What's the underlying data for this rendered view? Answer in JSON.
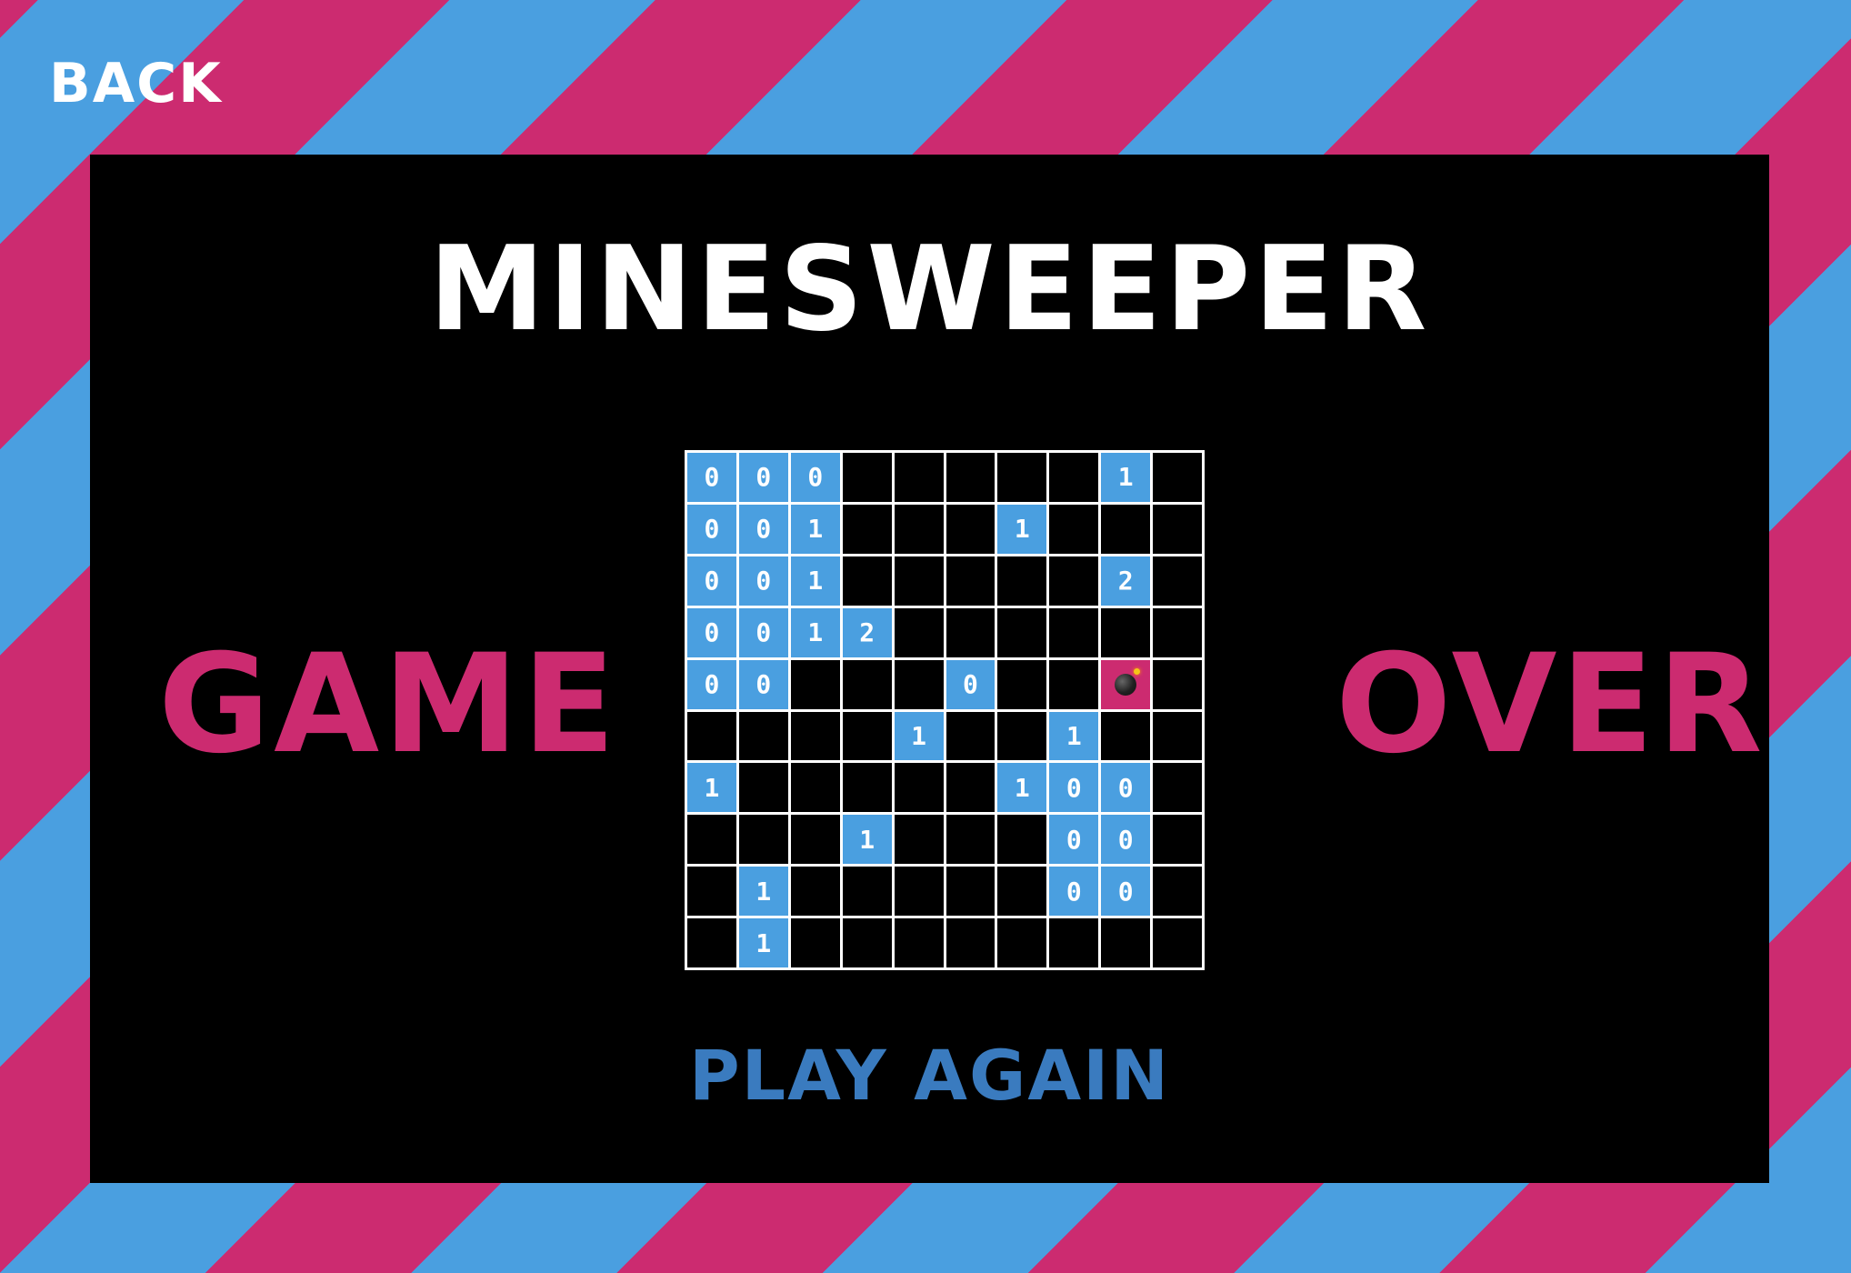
{
  "nav": {
    "back_label": "BACK"
  },
  "game": {
    "title": "MINESWEEPER",
    "status_left": "GAME",
    "status_right": "OVER",
    "play_again_label": "PLAY AGAIN"
  },
  "colors": {
    "stripe_blue": "#4a9fe0",
    "stripe_pink": "#cc2b70",
    "panel": "#000000",
    "revealed_cell": "#4a9fe0",
    "mine_cell": "#cc2b70",
    "play_again": "#3a7bbf"
  },
  "board": {
    "rows": 10,
    "cols": 10,
    "legend": {
      "H": "hidden",
      "M": "exploded-mine",
      "digit": "revealed-count"
    },
    "cells": [
      [
        "0",
        "0",
        "0",
        "H",
        "H",
        "H",
        "H",
        "H",
        "1",
        "H"
      ],
      [
        "0",
        "0",
        "1",
        "H",
        "H",
        "H",
        "1",
        "H",
        "H",
        "H"
      ],
      [
        "0",
        "0",
        "1",
        "H",
        "H",
        "H",
        "H",
        "H",
        "2",
        "H"
      ],
      [
        "0",
        "0",
        "1",
        "2",
        "H",
        "H",
        "H",
        "H",
        "H",
        "H"
      ],
      [
        "0",
        "0",
        "H",
        "H",
        "H",
        "0",
        "H",
        "H",
        "M",
        "H"
      ],
      [
        "H",
        "H",
        "H",
        "H",
        "1",
        "H",
        "H",
        "1",
        "H",
        "H"
      ],
      [
        "1",
        "H",
        "H",
        "H",
        "H",
        "H",
        "1",
        "0",
        "0",
        "H"
      ],
      [
        "H",
        "H",
        "H",
        "1",
        "H",
        "H",
        "H",
        "0",
        "0",
        "H"
      ],
      [
        "H",
        "1",
        "H",
        "H",
        "H",
        "H",
        "H",
        "0",
        "0",
        "H"
      ],
      [
        "H",
        "1",
        "H",
        "H",
        "H",
        "H",
        "H",
        "H",
        "H",
        "H"
      ]
    ],
    "mine_icon": "bomb-icon"
  }
}
